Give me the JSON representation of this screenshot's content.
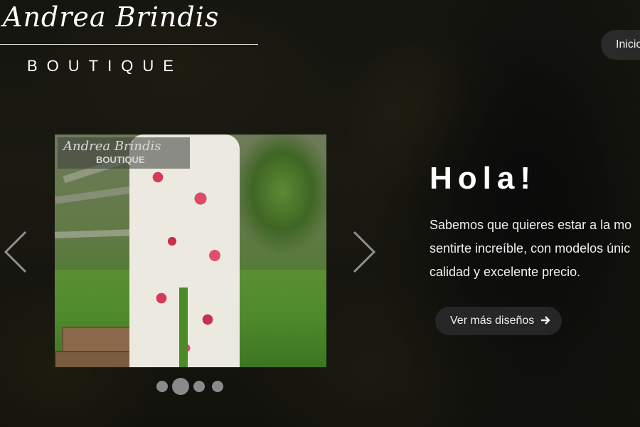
{
  "brand": {
    "script_name": "Andrea  Brindis",
    "subtitle": "BOUTIQUE"
  },
  "nav": {
    "items": [
      {
        "label": "Inicio"
      }
    ]
  },
  "carousel": {
    "image": {
      "watermark_script": "Andrea Brindis",
      "watermark_sub": "BOUTIQUE"
    },
    "prev_icon": "chevron-left-icon",
    "next_icon": "chevron-right-icon",
    "dots_count": 4,
    "active_index": 1
  },
  "hero": {
    "title": "Hola!",
    "lines": [
      "Sabemos que quieres estar a la mo",
      "sentirte increíble, con modelos únic",
      "calidad y excelente precio."
    ],
    "cta_label": "Ver más diseños",
    "cta_icon": "arrow-right-icon"
  },
  "colors": {
    "pill_bg": "#2a2a2a",
    "cta_bg": "#262626",
    "text": "#ffffff",
    "dot": "#8a8a8a"
  }
}
